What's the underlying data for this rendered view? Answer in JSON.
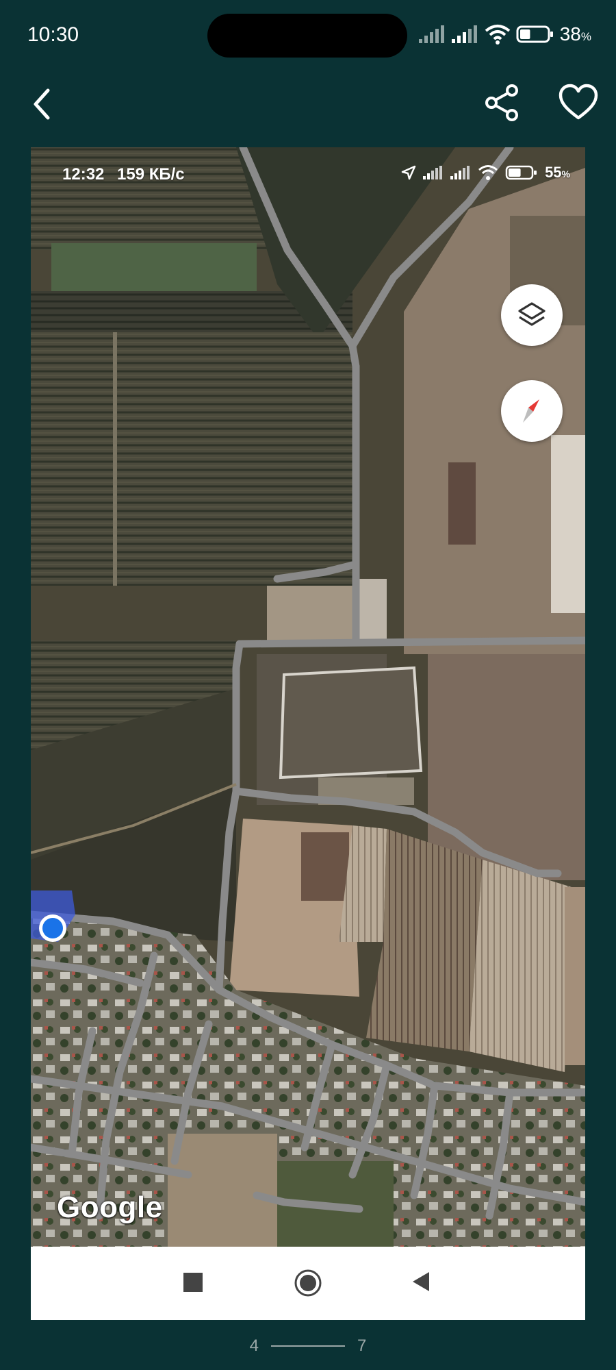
{
  "status_bar": {
    "time": "10:30",
    "battery_percent": "38",
    "battery_unit": "%",
    "battery_level": 0.38
  },
  "actions": {
    "back_icon": "chevron-left-icon",
    "share_icon": "share-icon",
    "favorite_icon": "heart-outline-icon"
  },
  "screenshot": {
    "status_bar": {
      "time": "12:32",
      "speed": "159 КБ/с",
      "battery_percent": "55",
      "battery_unit": "%",
      "battery_level": 0.55
    },
    "map": {
      "type": "satellite",
      "logo": "Google",
      "layers_button_icon": "layers-icon",
      "compass_button_icon": "compass-icon",
      "location_marker": "my-location-dot"
    },
    "nav_bar": {
      "recents_icon": "square-icon",
      "home_icon": "circle-icon",
      "back_icon": "triangle-back-icon"
    }
  },
  "pager": {
    "current": "4",
    "total": "7"
  },
  "colors": {
    "background": "#0a3234",
    "road": "#8a8a8a",
    "location_dot": "#1a73e8",
    "compass_red": "#e53935"
  }
}
